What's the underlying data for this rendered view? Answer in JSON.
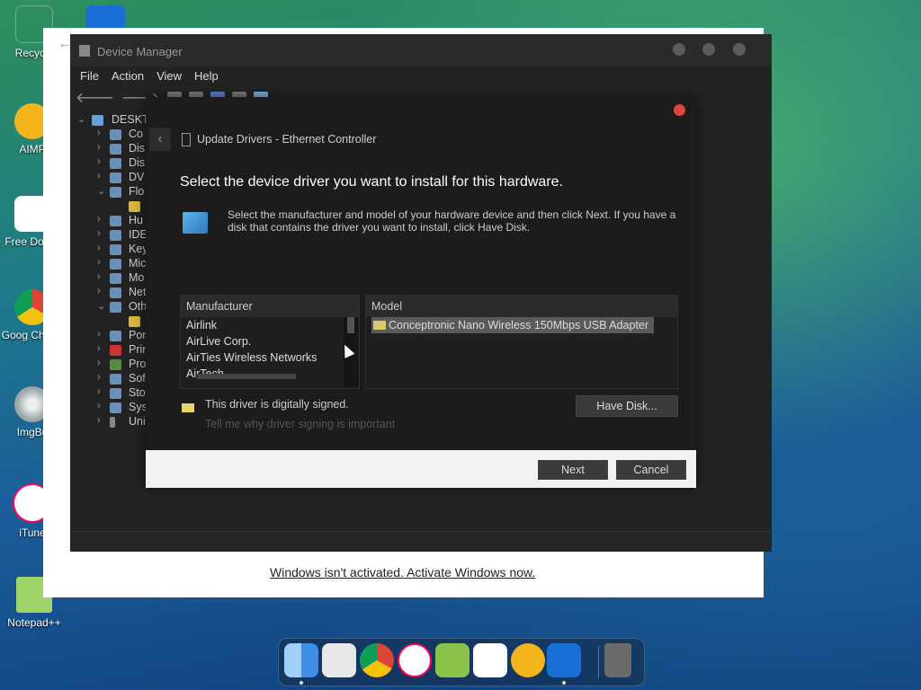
{
  "desktop": {
    "icons": [
      {
        "label": "Recycle"
      },
      {
        "label": "AIMP"
      },
      {
        "label": "Free Downl"
      },
      {
        "label": "Goog Chrom"
      },
      {
        "label": "ImgBu"
      },
      {
        "label": "iTune"
      },
      {
        "label": "Notepad++"
      }
    ]
  },
  "settings_window": {
    "activation_link": "Windows isn't activated. Activate Windows now."
  },
  "device_manager": {
    "title": "Device Manager",
    "menu": [
      "File",
      "Action",
      "View",
      "Help"
    ],
    "tree_root": "DESKT",
    "tree_items": [
      "Co",
      "Dis",
      "Dis",
      "DV",
      "Flo",
      "",
      "Hu",
      "IDE",
      "Key",
      "Mic",
      "Mo",
      "Net",
      "Oth",
      "",
      "Por",
      "Prin",
      "Pro",
      "Sof",
      "Sto",
      "Sys",
      "Uni"
    ]
  },
  "wizard": {
    "header_title": "Update Drivers - Ethernet Controller",
    "heading": "Select the device driver you want to install for this hardware.",
    "description": "Select the manufacturer and model of your hardware device and then click Next. If you have a disk that contains the driver you want to install, click Have Disk.",
    "manufacturer_header": "Manufacturer",
    "manufacturers": [
      "Airlink",
      "AirLive Corp.",
      "AirTies Wireless Networks",
      "AirTech"
    ],
    "model_header": "Model",
    "models": [
      "Conceptronic Nano Wireless 150Mbps USB Adapter"
    ],
    "signed_text": "This driver is digitally signed.",
    "signing_link": "Tell me why driver signing is important",
    "have_disk_label": "Have Disk...",
    "next_label": "Next",
    "cancel_label": "Cancel"
  },
  "dock": {
    "apps": [
      "finder-icon",
      "launchpad-icon",
      "chrome-icon",
      "itunes-icon",
      "imgburn-icon",
      "free-download-icon",
      "aimp-icon",
      "settings-icon",
      "trash-icon"
    ]
  },
  "colors": {
    "close_red": "#e0443e",
    "dialog_bg": "#1c1c1c",
    "selection": "#5a5a5a"
  }
}
